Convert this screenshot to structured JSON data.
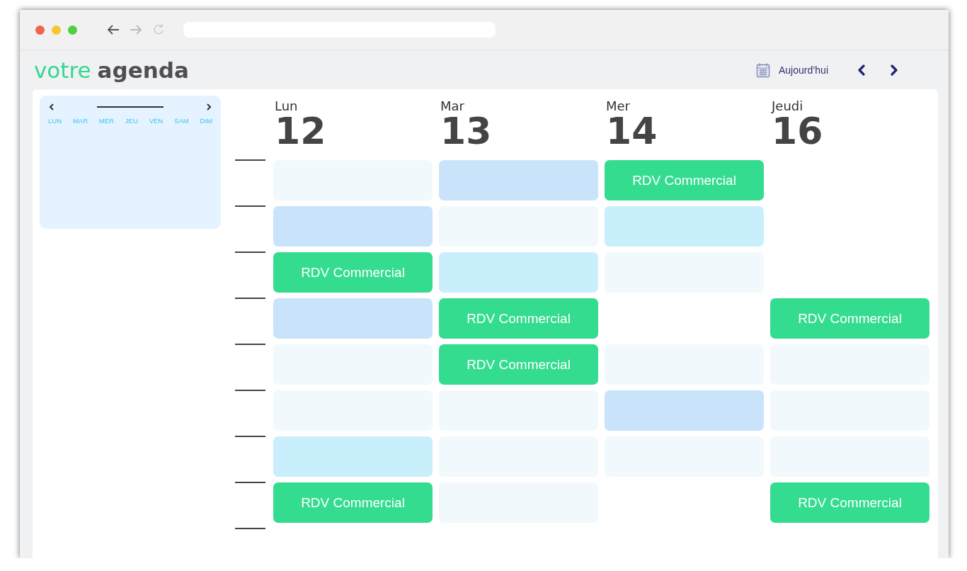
{
  "logo": {
    "light": "votre",
    "bold": "agenda"
  },
  "today_button": "Aujourd’hui",
  "mini_calendar": {
    "weekdays": [
      "LUN",
      "MAR",
      "MER",
      "JEU",
      "VEN",
      "SAM",
      "DIM"
    ]
  },
  "days": [
    {
      "name": "Lun",
      "number": "12",
      "slots": [
        {
          "kind": "faint"
        },
        {
          "kind": "blue"
        },
        {
          "kind": "event",
          "label": "RDV Commercial"
        },
        {
          "kind": "blue"
        },
        {
          "kind": "faint"
        },
        {
          "kind": "faint"
        },
        {
          "kind": "light"
        },
        {
          "kind": "event",
          "label": "RDV Commercial"
        }
      ]
    },
    {
      "name": "Mar",
      "number": "13",
      "slots": [
        {
          "kind": "blue"
        },
        {
          "kind": "faint"
        },
        {
          "kind": "light"
        },
        {
          "kind": "event",
          "label": "RDV Commercial"
        },
        {
          "kind": "event",
          "label": "RDV Commercial"
        },
        {
          "kind": "faint"
        },
        {
          "kind": "faint"
        },
        {
          "kind": "faint"
        }
      ]
    },
    {
      "name": "Mer",
      "number": "14",
      "slots": [
        {
          "kind": "event",
          "label": "RDV Commercial"
        },
        {
          "kind": "light"
        },
        {
          "kind": "faint"
        },
        {
          "kind": "none"
        },
        {
          "kind": "faint"
        },
        {
          "kind": "blue"
        },
        {
          "kind": "faint"
        },
        {
          "kind": "none"
        }
      ]
    },
    {
      "name": "Jeudi",
      "number": "16",
      "slots": [
        {
          "kind": "none"
        },
        {
          "kind": "none"
        },
        {
          "kind": "none"
        },
        {
          "kind": "event",
          "label": "RDV Commercial"
        },
        {
          "kind": "faint"
        },
        {
          "kind": "faint"
        },
        {
          "kind": "faint"
        },
        {
          "kind": "event",
          "label": "RDV Commercial"
        }
      ]
    }
  ]
}
